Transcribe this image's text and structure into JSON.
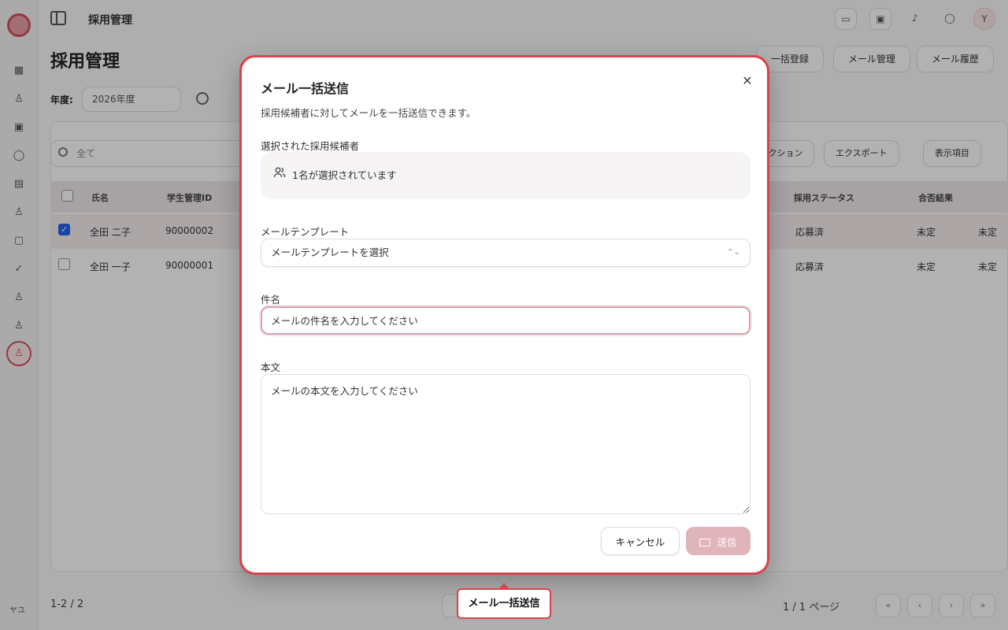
{
  "app": {
    "header_title": "採用管理",
    "page_title": "採用管理",
    "header_buttons": [
      "一括登録",
      "メール管理",
      "メール履歴"
    ],
    "year_label": "年度:",
    "year_value": "2026年度",
    "search_placeholder": "全て",
    "toolbar_buttons": [
      "アクション",
      "エクスポート",
      "表示項目"
    ],
    "table": {
      "columns": [
        "氏名",
        "学生管理ID",
        "採用ステータス",
        "合否結果"
      ],
      "rows": [
        {
          "name": "全田 二子",
          "id": "90000002",
          "status": "応募済",
          "result": "未定",
          "extra": "未定",
          "checked": true
        },
        {
          "name": "全田 一子",
          "id": "90000001",
          "status": "応募済",
          "result": "未定",
          "extra": "未定",
          "checked": false
        }
      ]
    },
    "footer_count": "1-2 / 2",
    "footer_page": "1 / 1 ページ",
    "sidebar_user": "ヤユ"
  },
  "dialog": {
    "title": "メール一括送信",
    "description": "採用候補者に対してメールを一括送信できます。",
    "selected_label": "選択された採用候補者",
    "selected_text": "1名が選択されています",
    "template_label": "メールテンプレート",
    "template_placeholder": "メールテンプレートを選択",
    "subject_label": "件名",
    "subject_placeholder": "メールの件名を入力してください",
    "body_label": "本文",
    "body_placeholder": "メールの本文を入力してください",
    "cancel_label": "キャンセル",
    "send_label": "送信"
  },
  "tooltip": {
    "text": "メール一括送信"
  },
  "colors": {
    "accent": "#d9424b",
    "send_disabled": "#e0b4bb",
    "focus_border": "#d9a2ad"
  }
}
